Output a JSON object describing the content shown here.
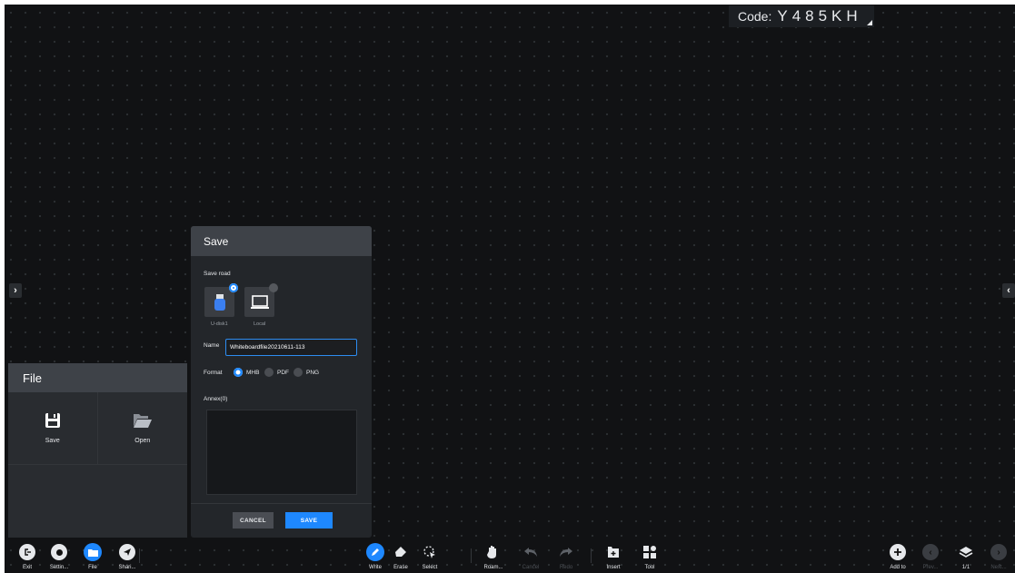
{
  "code": {
    "label": "Code:",
    "value": "Y485KH"
  },
  "file_panel": {
    "title": "File",
    "items": [
      {
        "label": "Save",
        "icon": "floppy-disk-icon"
      },
      {
        "label": "Open",
        "icon": "folder-open-icon"
      }
    ]
  },
  "save_dialog": {
    "title": "Save",
    "save_road_label": "Save road",
    "roads": [
      {
        "label": "U-disk1",
        "icon": "usb-drive-icon",
        "selected": true
      },
      {
        "label": "Local",
        "icon": "laptop-icon",
        "selected": false
      }
    ],
    "name_label": "Name",
    "name_value": "Whiteboardfile20210611-113",
    "format_label": "Format",
    "formats": [
      {
        "label": "MHB",
        "selected": true
      },
      {
        "label": "PDF",
        "selected": false
      },
      {
        "label": "PNG",
        "selected": false
      }
    ],
    "annex_label": "Annex(0)",
    "cancel_label": "CANCEL",
    "save_label": "SAVE"
  },
  "toolbar": {
    "left": [
      {
        "label": "Exit",
        "icon": "exit-icon"
      },
      {
        "label": "Settin...",
        "icon": "settings-icon"
      },
      {
        "label": "File",
        "icon": "folder-icon"
      },
      {
        "label": "Shari...",
        "icon": "share-icon"
      }
    ],
    "center": [
      {
        "label": "Write",
        "icon": "pen-icon",
        "active": true
      },
      {
        "label": "Erase",
        "icon": "eraser-icon"
      },
      {
        "label": "Select",
        "icon": "select-icon"
      },
      {
        "label": "Roam...",
        "icon": "hand-icon"
      },
      {
        "label": "Cancel",
        "icon": "undo-icon",
        "disabled": true
      },
      {
        "label": "Redo",
        "icon": "redo-icon",
        "disabled": true
      },
      {
        "label": "Insert",
        "icon": "insert-icon"
      },
      {
        "label": "Tool",
        "icon": "tool-grid-icon"
      }
    ],
    "right": [
      {
        "label": "Add to",
        "icon": "add-page-icon"
      },
      {
        "label": "Prev...",
        "icon": "prev-page-icon",
        "disabled": true
      },
      {
        "label": "1/1",
        "icon": "layers-icon"
      },
      {
        "label": "Next...",
        "icon": "next-page-icon",
        "disabled": true
      }
    ]
  },
  "colors": {
    "accent": "#1e88ff",
    "panel": "#292c30",
    "header": "#3e4248",
    "canvas": "#111214"
  }
}
